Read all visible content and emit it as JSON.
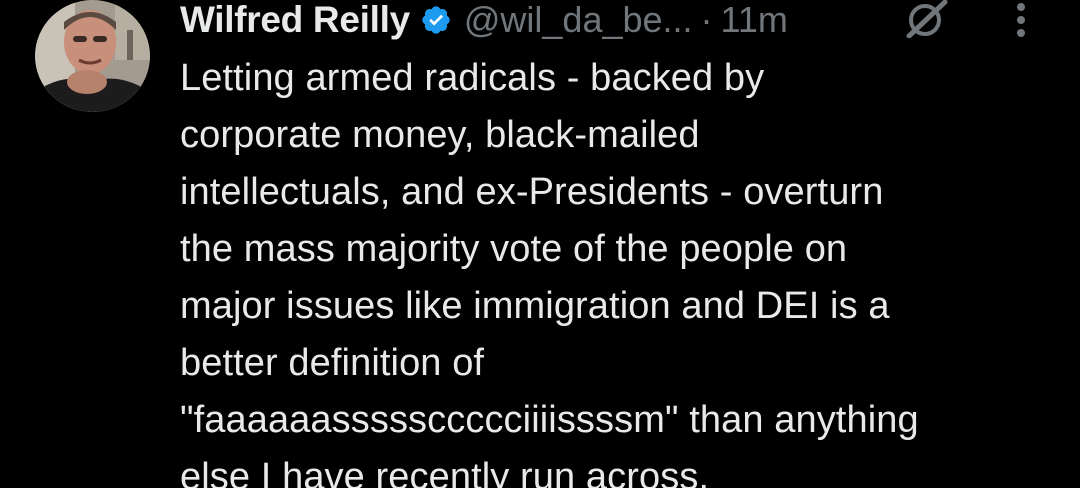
{
  "author": {
    "name": "Wilfred Reilly",
    "handle": "@wil_da_be...",
    "separator": "·",
    "time": "11m",
    "verified_color": "#1d9bf0"
  },
  "icons": {
    "verified": "verified-badge-icon",
    "grok": "grok-icon",
    "more": "more-options-icon"
  },
  "tweet": {
    "text": "Letting armed radicals -  backed by\ncorporate money, black-mailed\nintellectuals, and ex-Presidents - overturn\nthe mass majority vote of the people on\nmajor issues like immigration and DEI is a\nbetter definition of\n\"faaaaaasssssccccciiiissssm\" than anything\nelse I have recently run across."
  },
  "colors": {
    "background": "#000000",
    "text_primary": "#e7e9ea",
    "text_secondary": "#71767b"
  }
}
